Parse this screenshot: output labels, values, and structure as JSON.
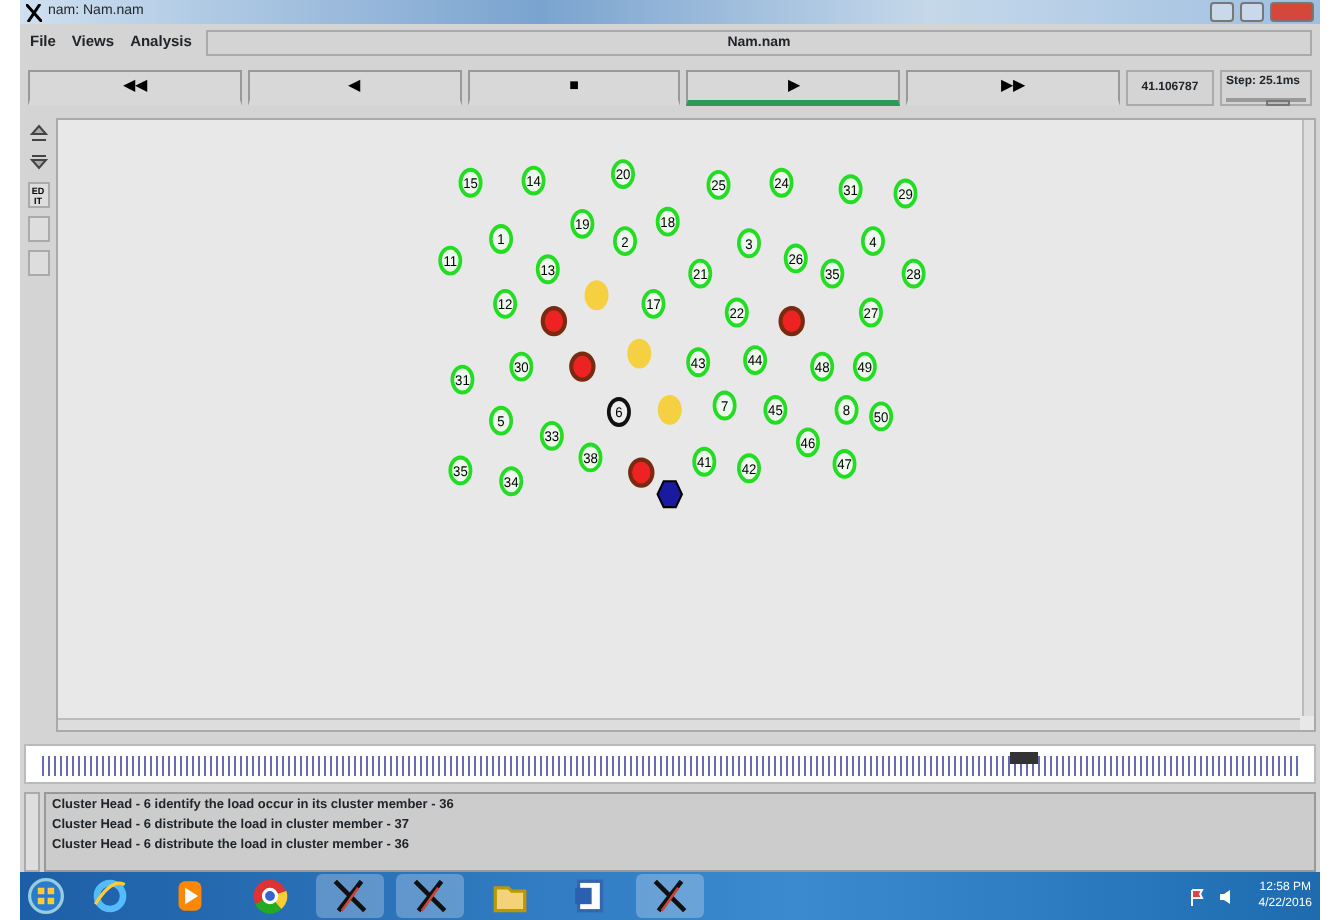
{
  "window": {
    "title": "nam: Nam.nam"
  },
  "menu": [
    {
      "label": "File"
    },
    {
      "label": "Views"
    },
    {
      "label": "Analysis"
    }
  ],
  "file_name": "Nam.nam",
  "controls": [
    {
      "label": "◀◀",
      "selected": false
    },
    {
      "label": "◀",
      "selected": false
    },
    {
      "label": "■",
      "selected": false
    },
    {
      "label": "▶",
      "selected": true
    },
    {
      "label": "▶▶",
      "selected": false
    }
  ],
  "time": "41.106787",
  "step": {
    "label": "Step: 25.1ms",
    "level": 0.7
  },
  "side_tools": [
    {
      "label": "ED\nIT"
    }
  ],
  "nodes": [
    {
      "label": "15",
      "kind": "circle",
      "color": "#22dd22"
    },
    {
      "label": "14",
      "kind": "circle",
      "color": "#22dd22"
    },
    {
      "label": "20",
      "kind": "circle",
      "color": "#22dd22"
    },
    {
      "label": "25",
      "kind": "circle",
      "color": "#22dd22"
    },
    {
      "label": "24",
      "kind": "circle",
      "color": "#22dd22"
    },
    {
      "label": "31",
      "kind": "circle",
      "color": "#22dd22"
    },
    {
      "label": "29",
      "kind": "circle",
      "color": "#22dd22"
    },
    {
      "label": "1",
      "kind": "circle",
      "color": "#22dd22"
    },
    {
      "label": "19",
      "kind": "circle",
      "color": "#22dd22"
    },
    {
      "label": "2",
      "kind": "circle",
      "color": "#22dd22"
    },
    {
      "label": "18",
      "kind": "circle",
      "color": "#22dd22"
    },
    {
      "label": "3",
      "kind": "circle",
      "color": "#22dd22"
    },
    {
      "label": "4",
      "kind": "circle",
      "color": "#22dd22"
    },
    {
      "label": "11",
      "kind": "circle",
      "color": "#22dd22"
    },
    {
      "label": "13",
      "kind": "circle",
      "color": "#22dd22"
    },
    {
      "label": "21",
      "kind": "circle",
      "color": "#22dd22"
    },
    {
      "label": "26",
      "kind": "circle",
      "color": "#22dd22"
    },
    {
      "label": "35",
      "kind": "circle",
      "color": "#22dd22"
    },
    {
      "label": "28",
      "kind": "circle",
      "color": "#22dd22"
    },
    {
      "label": "12",
      "kind": "circle",
      "color": "#22dd22"
    },
    {
      "kind": "circle",
      "color": "#ee2222"
    },
    {
      "kind": "circle",
      "color": "#f5d040"
    },
    {
      "label": "17",
      "kind": "circle",
      "color": "#22dd22"
    },
    {
      "label": "22",
      "kind": "circle",
      "color": "#22dd22"
    },
    {
      "kind": "circle",
      "color": "#ee2222"
    },
    {
      "label": "27",
      "kind": "circle",
      "color": "#22dd22"
    },
    {
      "label": "31",
      "kind": "circle",
      "color": "#22dd22"
    },
    {
      "label": "30",
      "kind": "circle",
      "color": "#22dd22"
    },
    {
      "kind": "circle",
      "color": "#ee2222"
    },
    {
      "kind": "circle",
      "color": "#f5d040"
    },
    {
      "label": "43",
      "kind": "circle",
      "color": "#22dd22"
    },
    {
      "label": "44",
      "kind": "circle",
      "color": "#22dd22"
    },
    {
      "label": "48",
      "kind": "circle",
      "color": "#22dd22"
    },
    {
      "label": "49",
      "kind": "circle",
      "color": "#22dd22"
    },
    {
      "label": "5",
      "kind": "circle",
      "color": "#22dd22"
    },
    {
      "label": "33",
      "kind": "circle",
      "color": "#22dd22"
    },
    {
      "label": "6",
      "kind": "circle",
      "color": "#111111"
    },
    {
      "kind": "circle",
      "color": "#f5d040"
    },
    {
      "label": "7",
      "kind": "circle",
      "color": "#22dd22"
    },
    {
      "label": "45",
      "kind": "circle",
      "color": "#22dd22"
    },
    {
      "label": "8",
      "kind": "circle",
      "color": "#22dd22"
    },
    {
      "label": "50",
      "kind": "circle",
      "color": "#22dd22"
    },
    {
      "label": "35",
      "kind": "circle",
      "color": "#22dd22"
    },
    {
      "label": "34",
      "kind": "circle",
      "color": "#22dd22"
    },
    {
      "label": "38",
      "kind": "circle",
      "color": "#22dd22"
    },
    {
      "kind": "circle",
      "color": "#ee2222"
    },
    {
      "label": "41",
      "kind": "circle",
      "color": "#22dd22"
    },
    {
      "label": "42",
      "kind": "circle",
      "color": "#22dd22"
    },
    {
      "label": "46",
      "kind": "circle",
      "color": "#22dd22"
    },
    {
      "label": "47",
      "kind": "circle",
      "color": "#22dd22"
    },
    {
      "kind": "hexagon",
      "color": "#1a1aa0"
    }
  ],
  "log": [
    "Cluster Head - 6 identify the load occur in its cluster member - 36",
    "Cluster Head - 6 distribute the load in cluster member - 37",
    "Cluster Head - 6 distribute the load in cluster member - 36"
  ],
  "taskbar": {
    "apps": [
      {
        "kind": "ie"
      },
      {
        "kind": "media"
      },
      {
        "kind": "chrome"
      },
      {
        "kind": "x"
      },
      {
        "kind": "x"
      },
      {
        "kind": "folder"
      },
      {
        "kind": "word"
      },
      {
        "kind": "x"
      }
    ],
    "clock": "12:58 PM",
    "date": "4/22/2016"
  }
}
